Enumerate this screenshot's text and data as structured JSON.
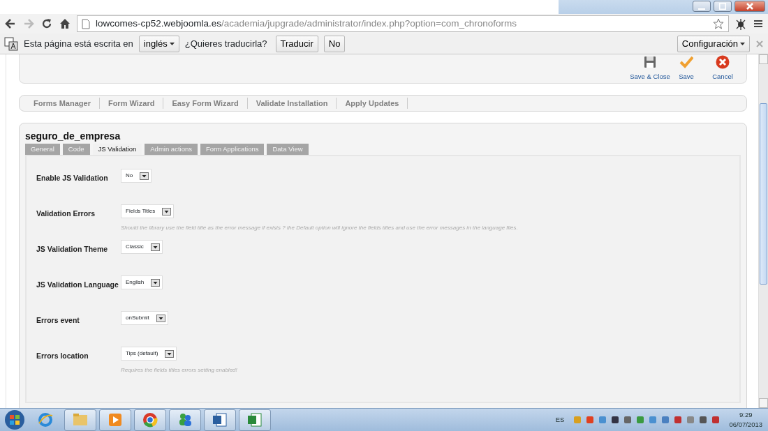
{
  "browser": {
    "url_host": "lowcomes-cp52.webjoomla.es",
    "url_path": "/academia/jupgrade/administrator/index.php?option=com_chronoforms"
  },
  "translate_bar": {
    "prompt": "Esta página está escrita en",
    "language": "inglés",
    "question": "¿Quieres traducirla?",
    "translate_button": "Traducir",
    "no_button": "No",
    "settings_button": "Configuración"
  },
  "toolbar": [
    {
      "kind": "save-close",
      "label": "Save & Close"
    },
    {
      "kind": "save",
      "label": "Save"
    },
    {
      "kind": "cancel",
      "label": "Cancel"
    }
  ],
  "menu": [
    "Forms Manager",
    "Form Wizard",
    "Easy Form Wizard",
    "Validate Installation",
    "Apply Updates"
  ],
  "form": {
    "title": "seguro_de_empresa",
    "tabs": [
      {
        "label": "General",
        "selected": false
      },
      {
        "label": "Code",
        "selected": false
      },
      {
        "label": "JS Validation",
        "selected": true
      },
      {
        "label": "Admin actions",
        "selected": false
      },
      {
        "label": "Form Applications",
        "selected": false
      },
      {
        "label": "Data View",
        "selected": false
      }
    ],
    "fields": [
      {
        "label": "Enable JS Validation",
        "value": "No"
      },
      {
        "label": "Validation Errors",
        "value": "Fields Titles",
        "help": "Should the library use the field title as the error message if exists ? the Default option will ignore the fields titles and use the error messages in the language files."
      },
      {
        "label": "JS Validation Theme",
        "value": "Classic"
      },
      {
        "label": "JS Validation Language",
        "value": "English"
      },
      {
        "label": "Errors event",
        "value": "onSubmit"
      },
      {
        "label": "Errors location",
        "value": "Tips (default)",
        "help": "Requires the fields titles errors setting enabled!"
      }
    ]
  },
  "taskbar": {
    "apps": [
      {
        "kind": "ie"
      },
      {
        "kind": "folder"
      },
      {
        "kind": "media"
      },
      {
        "kind": "chrome"
      },
      {
        "kind": "messenger"
      },
      {
        "kind": "word"
      },
      {
        "kind": "excel"
      }
    ],
    "language": "ES",
    "time": "9:29",
    "date": "06/07/2013"
  }
}
